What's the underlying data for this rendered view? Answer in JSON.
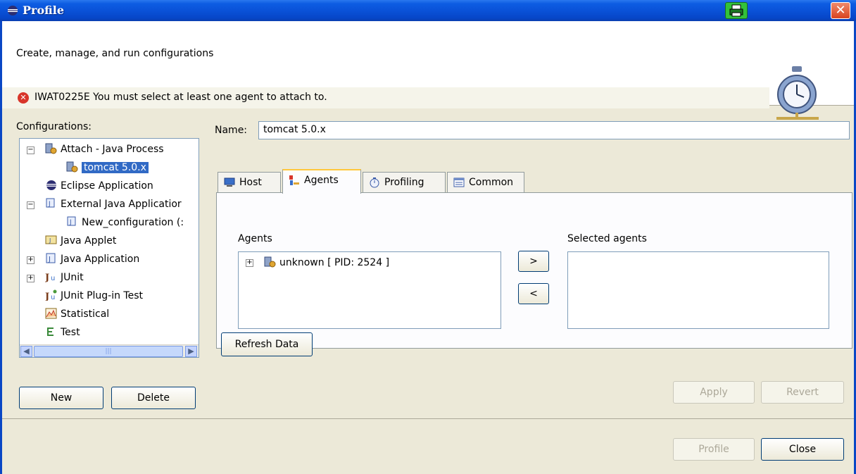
{
  "window": {
    "title": "Profile"
  },
  "header": {
    "description": "Create, manage, and run configurations",
    "error_code_message": "IWAT0225E You must select at least one agent to attach to."
  },
  "configurations": {
    "label": "Configurations:",
    "tree": [
      {
        "label": "Attach - Java Process",
        "icon": "attach-icon",
        "expanded": true
      },
      {
        "label": "tomcat 5.0.x",
        "icon": "attach-icon",
        "selected": true
      },
      {
        "label": "Eclipse Application",
        "icon": "eclipse-icon"
      },
      {
        "label": "External Java Applicatior",
        "icon": "external-java-icon",
        "expanded": true
      },
      {
        "label": "New_configuration (:",
        "icon": "external-java-icon"
      },
      {
        "label": "Java Applet",
        "icon": "applet-icon"
      },
      {
        "label": "Java Application",
        "icon": "java-app-icon",
        "expanded": false
      },
      {
        "label": "JUnit",
        "icon": "junit-icon",
        "expanded": false
      },
      {
        "label": "JUnit Plug-in Test",
        "icon": "junit-plugin-icon"
      },
      {
        "label": "Statistical",
        "icon": "statistical-icon"
      },
      {
        "label": "Test",
        "icon": "test-icon"
      }
    ],
    "new_label": "New",
    "delete_label": "Delete"
  },
  "name": {
    "label": "Name:",
    "value": "tomcat 5.0.x"
  },
  "tabs": [
    {
      "label": "Host",
      "icon": "host-icon"
    },
    {
      "label": "Agents",
      "icon": "agents-icon",
      "active": true
    },
    {
      "label": "Profiling",
      "icon": "profiling-icon"
    },
    {
      "label": "Common",
      "icon": "common-icon"
    }
  ],
  "agents": {
    "agents_label": "Agents",
    "selected_label": "Selected agents",
    "agent_item": "unknown [ PID: 2524 ]",
    "add_label": ">",
    "remove_label": "<",
    "refresh_label": "Refresh Data"
  },
  "actions": {
    "apply_label": "Apply",
    "revert_label": "Revert",
    "profile_label": "Profile",
    "close_label": "Close"
  },
  "colors": {
    "titlebar": "#0a52d8",
    "selection": "#316ac5",
    "error": "#d8352a",
    "active_tab_accent": "#ffc83c"
  }
}
